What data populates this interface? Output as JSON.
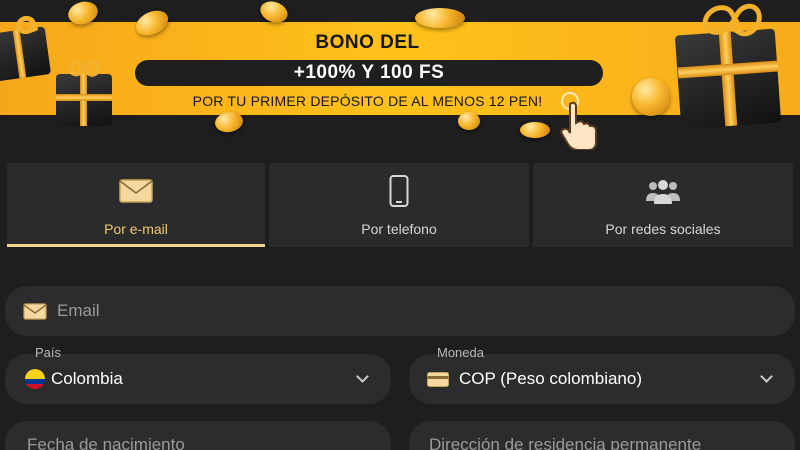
{
  "banner": {
    "title": "BONO DEL",
    "highlight": "+100% Y 100 FS",
    "subtitle": "POR TU PRIMER DEPÓSITO DE AL MENOS 12 PEN!",
    "accent_color": "#ffc21a"
  },
  "tabs": [
    {
      "label": "Por e-mail",
      "icon": "envelope-icon",
      "active": true
    },
    {
      "label": "Por telefono",
      "icon": "phone-icon",
      "active": false
    },
    {
      "label": "Por redes sociales",
      "icon": "people-icon",
      "active": false
    }
  ],
  "form": {
    "email": {
      "placeholder": "Email",
      "icon": "envelope-icon"
    },
    "country": {
      "label": "País",
      "value": "Colombia",
      "icon": "colombia-flag-icon"
    },
    "currency": {
      "label": "Moneda",
      "value": "COP (Peso colombiano)",
      "icon": "card-icon"
    },
    "birthdate": {
      "placeholder": "Fecha de nacimiento"
    },
    "address": {
      "placeholder": "Dirección de residencia permanente"
    }
  }
}
